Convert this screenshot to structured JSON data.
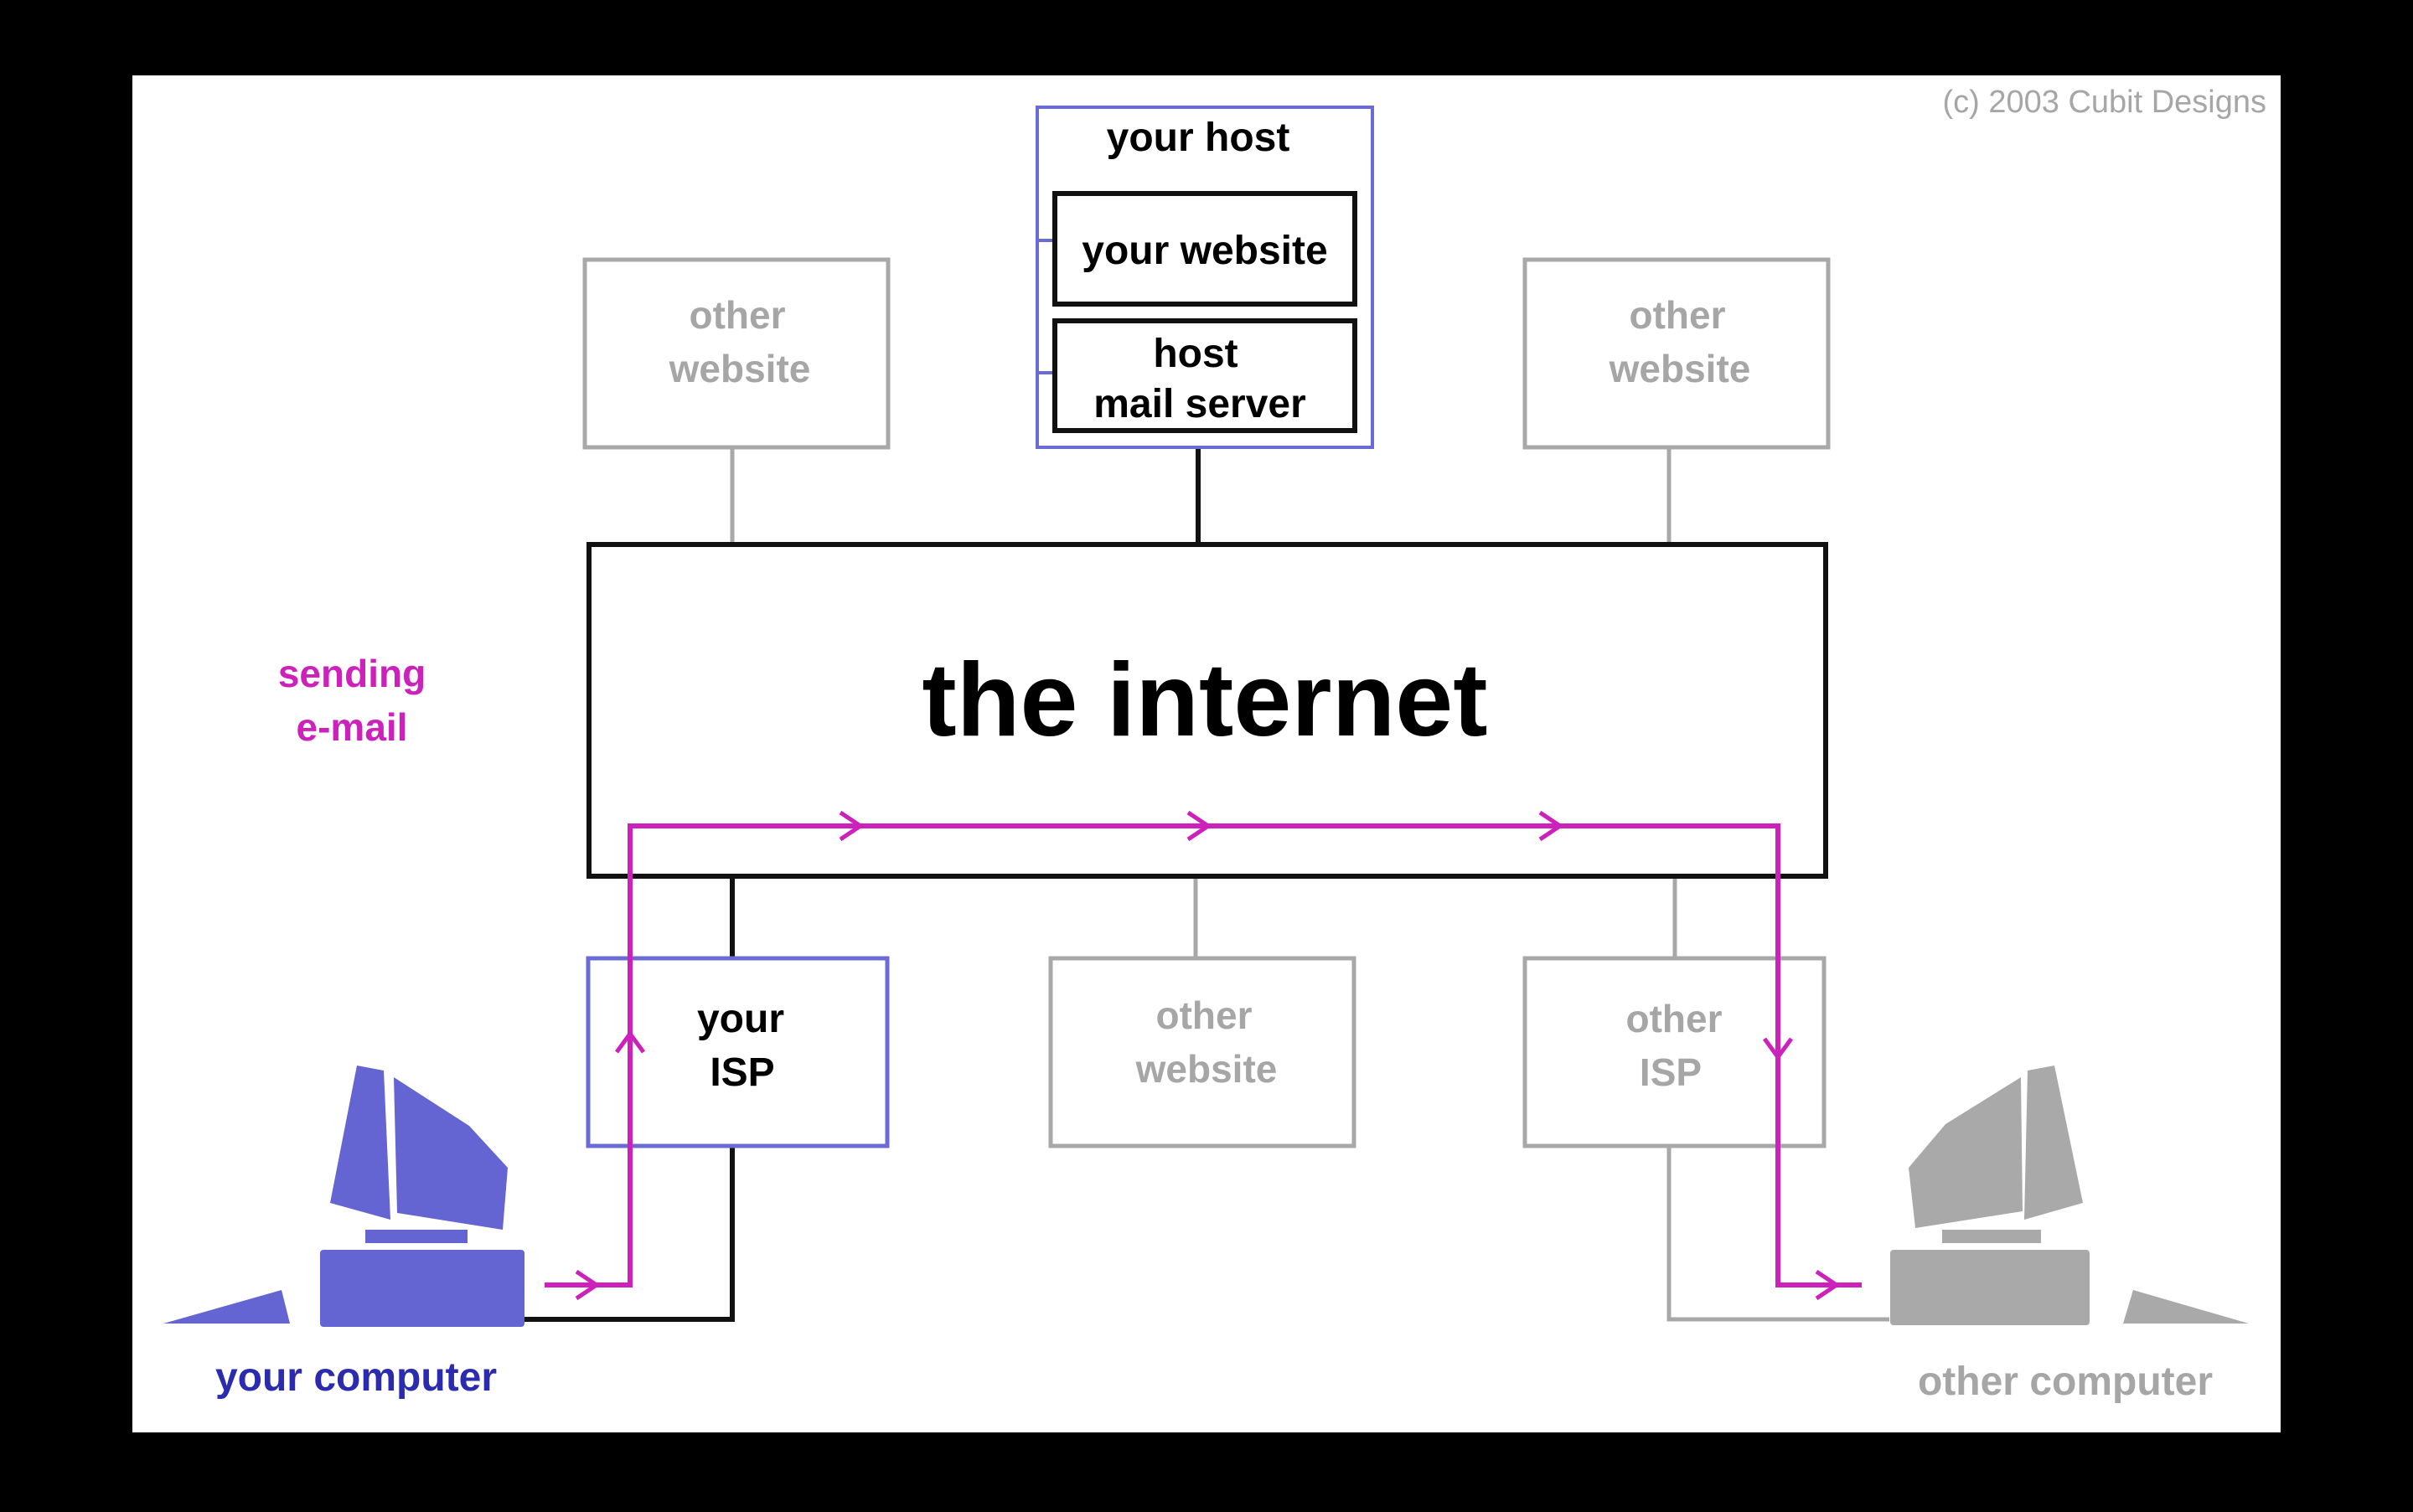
{
  "colors": {
    "canvas": "#ffffff",
    "background": "#000000",
    "black_box": "#111111",
    "gray_box": "#a8a8a8",
    "blue_box": "#6b6bd6",
    "route": "#cc22bb",
    "your_computer": "#6464d2",
    "other_computer": "#a9a9a9"
  },
  "copyright": "(c) 2003 Cubit Designs",
  "host": {
    "title": "your host",
    "website": "your website",
    "mail_server_line1": "host",
    "mail_server_line2": "mail server"
  },
  "top_left_site": {
    "line1": "other",
    "line2": "website"
  },
  "top_right_site": {
    "line1": "other",
    "line2": "website"
  },
  "internet": {
    "label": "the internet"
  },
  "your_isp": {
    "line1": "your",
    "line2": "ISP"
  },
  "middle_site": {
    "line1": "other",
    "line2": "website"
  },
  "other_isp": {
    "line1": "other",
    "line2": "ISP"
  },
  "annotation": {
    "line1": "sending",
    "line2": "e-mail"
  },
  "your_computer": {
    "label": "your computer",
    "icon": "desktop-computer-icon"
  },
  "other_computer": {
    "label": "other computer",
    "icon": "desktop-computer-icon"
  }
}
